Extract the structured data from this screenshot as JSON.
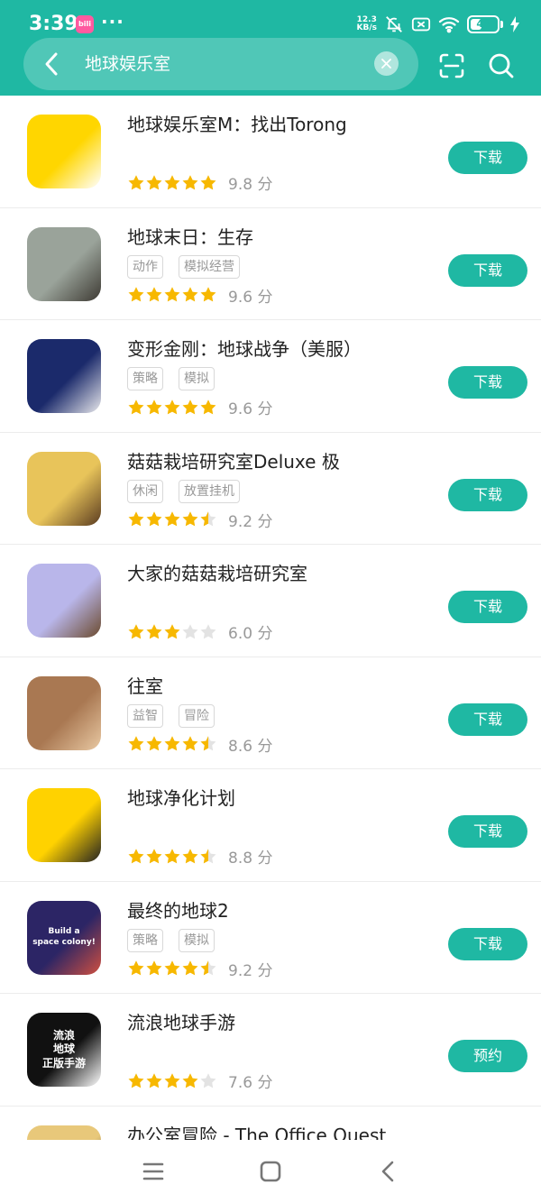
{
  "status_bar": {
    "time": "3:39",
    "app_badge": "bilibili",
    "dots": "···",
    "net_speed_value": "12.3",
    "net_speed_unit": "KB/s",
    "battery": "43",
    "battery_level": 0.43
  },
  "search": {
    "query": "地球娱乐室"
  },
  "apps": [
    {
      "name": "地球娱乐室M：找出Torong",
      "tags": [],
      "rating": 5,
      "score": "9.8 分",
      "button": "下载",
      "icon_colors": [
        "#ffd600",
        "#ffffff"
      ]
    },
    {
      "name": "地球末日：生存",
      "tags": [
        "动作",
        "模拟经营"
      ],
      "rating": 5,
      "score": "9.6 分",
      "button": "下载",
      "icon_colors": [
        "#9aa39a",
        "#3d3a33"
      ]
    },
    {
      "name": "变形金刚：地球战争（美服）",
      "tags": [
        "策略",
        "模拟"
      ],
      "rating": 5,
      "score": "9.6 分",
      "button": "下载",
      "icon_colors": [
        "#1b2a6b",
        "#e8e8ec"
      ]
    },
    {
      "name": "菇菇栽培研究室Deluxe 极",
      "tags": [
        "休闲",
        "放置挂机"
      ],
      "rating": 4.5,
      "score": "9.2 分",
      "button": "下载",
      "icon_colors": [
        "#e8c45a",
        "#5a3b20"
      ]
    },
    {
      "name": "大家的菇菇栽培研究室",
      "tags": [],
      "rating": 3,
      "score": "6.0 分",
      "button": "下载",
      "icon_colors": [
        "#b9b6ea",
        "#6b4a2e"
      ]
    },
    {
      "name": "往室",
      "tags": [
        "益智",
        "冒险"
      ],
      "rating": 4.5,
      "score": "8.6 分",
      "button": "下载",
      "icon_colors": [
        "#a97852",
        "#e9c9a3"
      ]
    },
    {
      "name": "地球净化计划",
      "tags": [],
      "rating": 4.5,
      "score": "8.8 分",
      "button": "下载",
      "icon_colors": [
        "#ffd200",
        "#222222"
      ]
    },
    {
      "name": "最终的地球2",
      "tags": [
        "策略",
        "模拟"
      ],
      "rating": 4.5,
      "score": "9.2 分",
      "button": "下载",
      "icon_colors": [
        "#2c2565",
        "#d05040"
      ],
      "icon_text": [
        "Build a",
        "space colony!"
      ]
    },
    {
      "name": "流浪地球手游",
      "tags": [],
      "rating": 4,
      "score": "7.6 分",
      "button": "预约",
      "icon_colors": [
        "#111111",
        "#ffffff"
      ],
      "icon_text": [
        "流浪",
        "地球",
        "正版手游"
      ]
    },
    {
      "name": "办公室冒险 - The Office Quest",
      "tags": [],
      "rating": 0,
      "score": "",
      "button": "",
      "icon_colors": [
        "#e8c87a",
        "#222222"
      ]
    }
  ],
  "colors": {
    "accent": "#1fb8a3",
    "star_on": "#f7b800",
    "star_off": "#e3e3e3"
  }
}
